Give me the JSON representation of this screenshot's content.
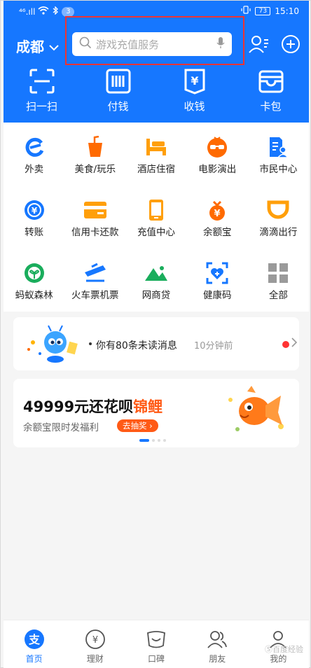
{
  "status_bar": {
    "network": "⁴⁶.ıll",
    "notification_count": "3",
    "battery": "73",
    "time": "15:10"
  },
  "header": {
    "city": "成都",
    "search_placeholder": "游戏充值服务"
  },
  "quick_actions": [
    {
      "label": "扫一扫",
      "icon": "scan-icon"
    },
    {
      "label": "付钱",
      "icon": "barcode-icon"
    },
    {
      "label": "收钱",
      "icon": "receive-money-icon"
    },
    {
      "label": "卡包",
      "icon": "card-wallet-icon"
    }
  ],
  "services": [
    [
      {
        "label": "外卖",
        "icon": "takeout-icon",
        "color": "#1677ff"
      },
      {
        "label": "美食/玩乐",
        "icon": "food-icon",
        "color": "#ff6a00"
      },
      {
        "label": "酒店住宿",
        "icon": "hotel-icon",
        "color": "#ff9f0a"
      },
      {
        "label": "电影演出",
        "icon": "movie-icon",
        "color": "#ff6a00"
      },
      {
        "label": "市民中心",
        "icon": "citizen-icon",
        "color": "#1677ff"
      }
    ],
    [
      {
        "label": "转账",
        "icon": "transfer-icon",
        "color": "#1677ff"
      },
      {
        "label": "信用卡还款",
        "icon": "credit-card-icon",
        "color": "#ff9f0a"
      },
      {
        "label": "充值中心",
        "icon": "phone-topup-icon",
        "color": "#ff9f0a"
      },
      {
        "label": "余额宝",
        "icon": "yuebao-icon",
        "color": "#ff6a00"
      },
      {
        "label": "滴滴出行",
        "icon": "didi-icon",
        "color": "#ff9f0a"
      }
    ],
    [
      {
        "label": "蚂蚁森林",
        "icon": "forest-icon",
        "color": "#1aad5c"
      },
      {
        "label": "火车票机票",
        "icon": "train-icon",
        "color": "#1677ff"
      },
      {
        "label": "网商贷",
        "icon": "loan-icon",
        "color": "#1aad5c"
      },
      {
        "label": "健康码",
        "icon": "health-code-icon",
        "color": "#1677ff"
      },
      {
        "label": "全部",
        "icon": "all-grid-icon",
        "color": "#9a9a9a"
      }
    ]
  ],
  "message": {
    "text": "你有80条未读消息",
    "time": "10分钟前"
  },
  "promo": {
    "title_main": "49999元还花呗",
    "title_highlight": "锦鲤",
    "subtitle": "余额宝限时发福利",
    "cta": "去抽奖 ›"
  },
  "tabs": [
    {
      "label": "首页",
      "icon": "home-alipay-icon",
      "active": true
    },
    {
      "label": "理财",
      "icon": "finance-icon",
      "active": false
    },
    {
      "label": "口碑",
      "icon": "koubei-icon",
      "active": false
    },
    {
      "label": "朋友",
      "icon": "friends-icon",
      "active": false
    },
    {
      "label": "我的",
      "icon": "profile-icon",
      "active": false
    }
  ],
  "watermark": "Ⓢ百度经验"
}
